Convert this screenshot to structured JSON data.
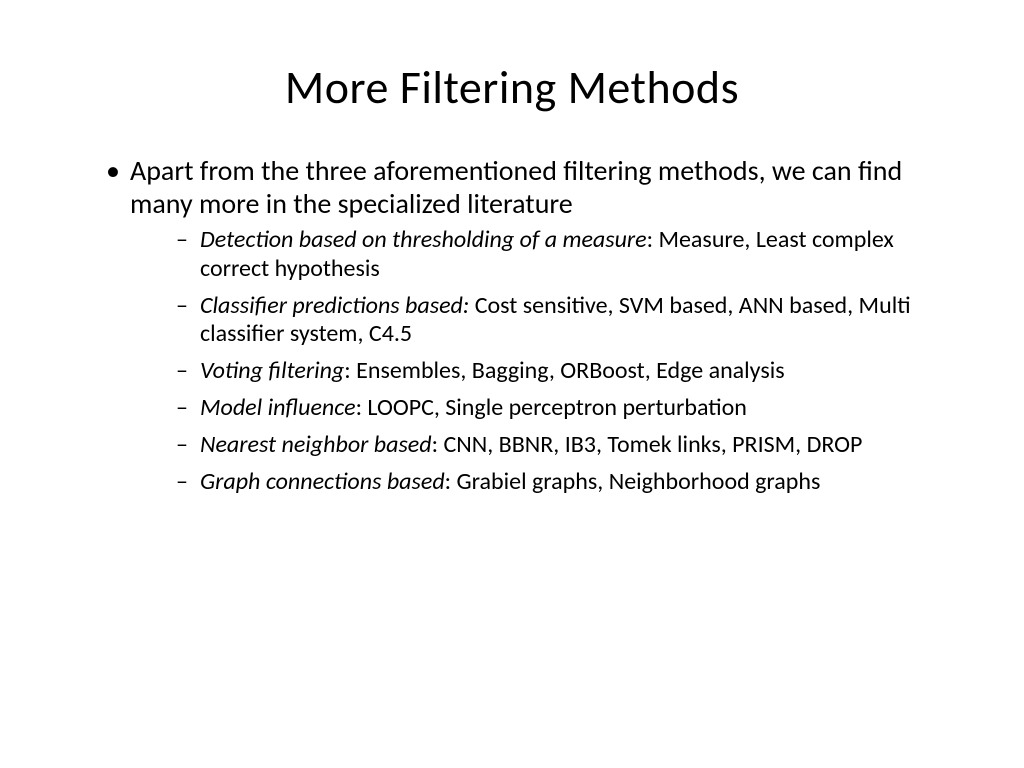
{
  "title": "More Filtering Methods",
  "main_bullet": "Apart from the three aforementioned filtering methods, we can find many more in the specialized literature",
  "sub_items": [
    {
      "label": "Detection based on thresholding of a measure",
      "text": ": Measure, Least complex correct hypothesis"
    },
    {
      "label": "Classifier predictions based:",
      "text": " Cost sensitive, SVM based, ANN based, Multi classifier system, C4.5"
    },
    {
      "label": "Voting filtering",
      "text": ": Ensembles, Bagging, ORBoost, Edge analysis"
    },
    {
      "label": "Model influence",
      "text": ": LOOPC, Single perceptron perturbation"
    },
    {
      "label": " Nearest neighbor based",
      "text": ": CNN, BBNR, IB3, Tomek links, PRISM, DROP"
    },
    {
      "label": "Graph connections based",
      "text": ": Grabiel graphs, Neighborhood graphs"
    }
  ]
}
